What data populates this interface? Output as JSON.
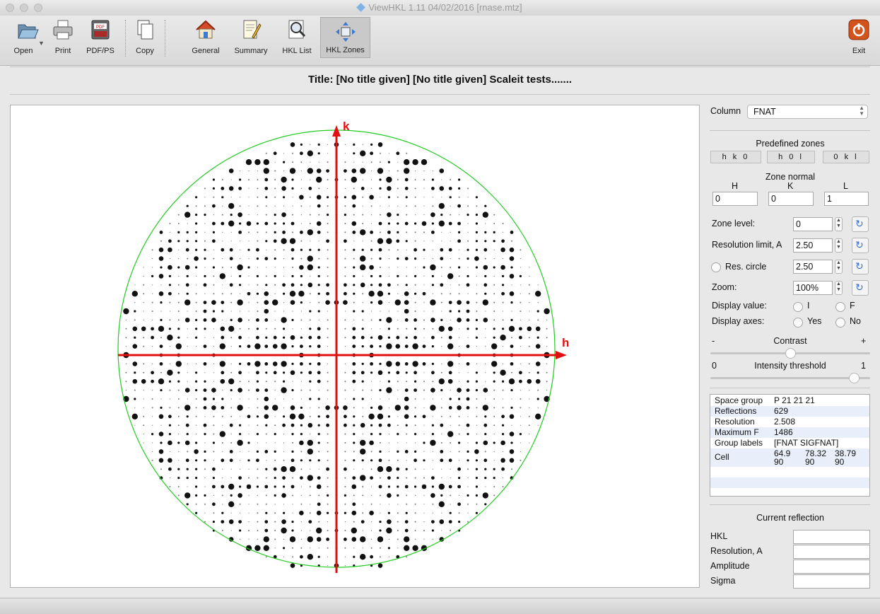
{
  "window": {
    "title": "ViewHKL 1.11 04/02/2016 [rnase.mtz]"
  },
  "toolbar": {
    "open": "Open",
    "print": "Print",
    "pdf": "PDF/PS",
    "copy": "Copy",
    "general": "General",
    "summary": "Summary",
    "hkl_list": "HKL List",
    "hkl_zones": "HKL Zones",
    "exit": "Exit",
    "pdf_badge": "PDF"
  },
  "doc_title": "Title: [No title given] [No title given] Scaleit tests.......",
  "plot": {
    "k_label": "k",
    "h_label": "h",
    "circle_color": "#22cc22",
    "axis_color": "#e01010"
  },
  "panel": {
    "column_label": "Column",
    "column_value": "FNAT",
    "predefined_title": "Predefined zones",
    "zones": [
      "h k 0",
      "h 0 l",
      "0 k l"
    ],
    "zone_normal_title": "Zone normal",
    "h_label": "H",
    "k_label": "K",
    "l_label": "L",
    "h_value": "0",
    "k_value": "0",
    "l_value": "1",
    "zone_level_label": "Zone level:",
    "zone_level_value": "0",
    "res_limit_label": "Resolution limit, A",
    "res_limit_value": "2.50",
    "res_circle_label": "Res. circle",
    "res_circle_value": "2.50",
    "zoom_label": "Zoom:",
    "zoom_value": "100%",
    "display_value_label": "Display value:",
    "display_value_i": "I",
    "display_value_f": "F",
    "display_axes_label": "Display axes:",
    "yes": "Yes",
    "no": "No",
    "contrast_minus": "-",
    "contrast_label": "Contrast",
    "contrast_plus": "+",
    "threshold_min": "0",
    "threshold_label": "Intensity threshold",
    "threshold_max": "1",
    "contrast_level": 0.5,
    "threshold_level": 0.9
  },
  "info": {
    "rows": [
      {
        "key": "Space group",
        "value": "P 21 21 21"
      },
      {
        "key": "Reflections",
        "value": "629"
      },
      {
        "key": "Resolution",
        "value": "2.508"
      },
      {
        "key": "Maximum F",
        "value": "1486"
      },
      {
        "key": "Group labels",
        "value": "[FNAT SIGFNAT]"
      }
    ],
    "cell_label": "Cell",
    "cell_line1": [
      "64.9",
      "78.32",
      "38.79"
    ],
    "cell_line2": [
      "90",
      "90",
      "90"
    ]
  },
  "current": {
    "title": "Current reflection",
    "hkl_label": "HKL",
    "res_label": "Resolution, A",
    "amp_label": "Amplitude",
    "sigma_label": "Sigma"
  }
}
